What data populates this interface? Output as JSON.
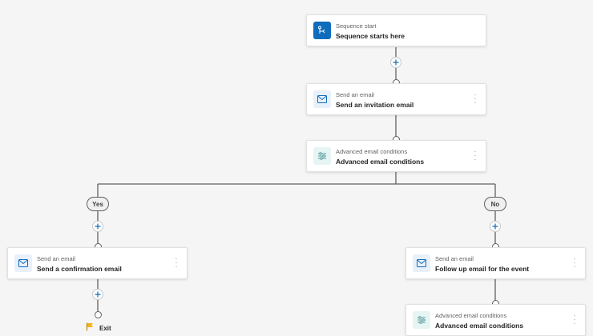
{
  "colors": {
    "accent": "#0f6cbd",
    "connector": "#616161",
    "plus": "#0f6cbd",
    "exit_flag": "#f2b11b"
  },
  "start": {
    "type": "Sequence start",
    "title": "Sequence starts here",
    "icon": "sequence-start-icon"
  },
  "invite": {
    "type": "Send an email",
    "title": "Send an invitation email",
    "icon": "email-icon"
  },
  "conditions_top": {
    "type": "Advanced email conditions",
    "title": "Advanced email conditions",
    "icon": "conditions-icon"
  },
  "branch": {
    "yes_label": "Yes",
    "no_label": "No"
  },
  "confirm": {
    "type": "Send an email",
    "title": "Send a confirmation email",
    "icon": "email-icon"
  },
  "followup": {
    "type": "Send an email",
    "title": "Follow up email for the event",
    "icon": "email-icon"
  },
  "conditions_bottom": {
    "type": "Advanced email conditions",
    "title": "Advanced email conditions",
    "icon": "conditions-icon"
  },
  "exit": {
    "label": "Exit",
    "icon": "flag-icon"
  }
}
